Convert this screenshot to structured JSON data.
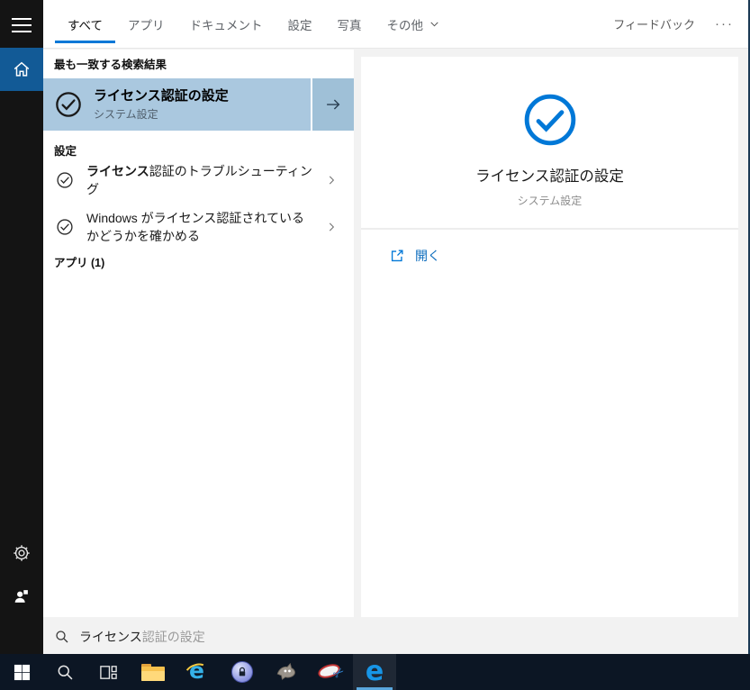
{
  "tabs": {
    "items": [
      {
        "label": "すべて",
        "active": true
      },
      {
        "label": "アプリ",
        "active": false
      },
      {
        "label": "ドキュメント",
        "active": false
      },
      {
        "label": "設定",
        "active": false
      },
      {
        "label": "写真",
        "active": false
      },
      {
        "label": "その他",
        "active": false,
        "has_dropdown": true
      }
    ],
    "feedback_label": "フィードバック",
    "more_label": "···"
  },
  "results": {
    "best_match": {
      "header": "最も一致する検索結果",
      "title": "ライセンス認証の設定",
      "subtitle": "システム設定"
    },
    "settings_section": {
      "header": "設定",
      "items": [
        {
          "label_bold": "ライセンス",
          "label_rest": "認証のトラブルシューティング"
        },
        {
          "label_bold": "",
          "label_rest": "Windows がライセンス認証されているかどうかを確かめる"
        }
      ]
    },
    "apps_section": {
      "header": "アプリ (1)"
    }
  },
  "preview": {
    "title": "ライセンス認証の設定",
    "subtitle": "システム設定",
    "open_label": "開く"
  },
  "search_box": {
    "typed": "ライセンス",
    "suggestion": "認証の設定"
  },
  "taskbar": {
    "icons": [
      "windows-start",
      "search",
      "task-view",
      "file-explorer",
      "internet-explorer",
      "keepass",
      "gimp",
      "snipping-tool",
      "edge"
    ],
    "active_app": "edge",
    "ie_glyph": "e",
    "edge_glyph": "e",
    "scissors_glyph": "✂"
  },
  "sidebar_icons": [
    "hamburger-menu",
    "home",
    "settings-gear",
    "user-accounts"
  ],
  "colors": {
    "accent": "#0078d7",
    "best_match_highlight": "#aac8df",
    "best_match_arrow_box": "#9fc0d7",
    "sidebar_home_active": "#125a96",
    "sidebar_bg": "#141414",
    "taskbar_bg": "#0c1624",
    "window_border": "#1b3a55",
    "link_blue": "#0b6cbd"
  }
}
